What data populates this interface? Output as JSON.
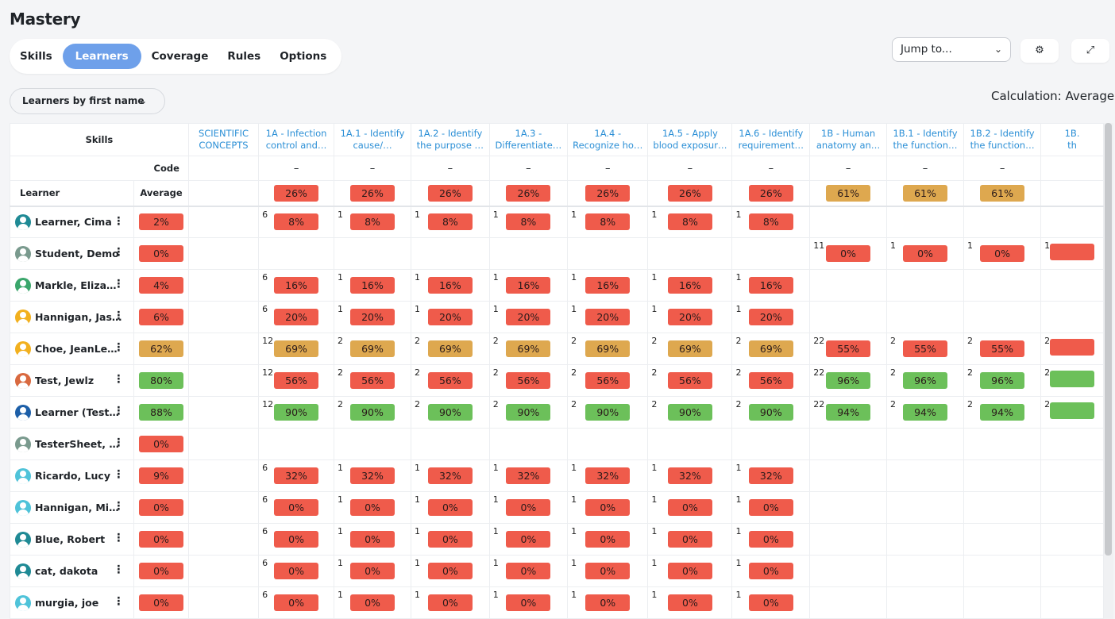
{
  "page": {
    "title": "Mastery"
  },
  "tabs": [
    {
      "label": "Skills",
      "active": false
    },
    {
      "label": "Learners",
      "active": true
    },
    {
      "label": "Coverage",
      "active": false
    },
    {
      "label": "Rules",
      "active": false
    },
    {
      "label": "Options",
      "active": false
    }
  ],
  "toolbar": {
    "jump_label": "Jump to...",
    "settings_icon": "gear-icon",
    "expand_icon": "expand-icon"
  },
  "filter": {
    "label": "Learners by first name"
  },
  "calculation": "Calculation: Average",
  "colors": {
    "accent": "#6ea0ea",
    "red": "#ef5b4b",
    "amber": "#dea84f",
    "green": "#6cc05a",
    "link": "#2b8fd6"
  },
  "grid": {
    "skills_label": "Skills",
    "code_label": "Code",
    "learner_label": "Learner",
    "average_label": "Average",
    "skills": [
      {
        "line1": "SCIENTIFIC",
        "line2": "CONCEPTS",
        "code": "",
        "avg": "",
        "avg_color": ""
      },
      {
        "line1": "1A - Infection",
        "line2": "control and…",
        "code": "–",
        "avg": "26%",
        "avg_color": "red"
      },
      {
        "line1": "1A.1 - Identify",
        "line2": "cause/…",
        "code": "–",
        "avg": "26%",
        "avg_color": "red"
      },
      {
        "line1": "1A.2 - Identify",
        "line2": "the purpose …",
        "code": "–",
        "avg": "26%",
        "avg_color": "red"
      },
      {
        "line1": "1A.3 -",
        "line2": "Differentiate…",
        "code": "–",
        "avg": "26%",
        "avg_color": "red"
      },
      {
        "line1": "1A.4 -",
        "line2": "Recognize ho…",
        "code": "–",
        "avg": "26%",
        "avg_color": "red"
      },
      {
        "line1": "1A.5 - Apply",
        "line2": "blood exposur…",
        "code": "–",
        "avg": "26%",
        "avg_color": "red"
      },
      {
        "line1": "1A.6 - Identify",
        "line2": "requirement…",
        "code": "–",
        "avg": "26%",
        "avg_color": "red"
      },
      {
        "line1": "1B - Human",
        "line2": "anatomy an…",
        "code": "–",
        "avg": "61%",
        "avg_color": "amber"
      },
      {
        "line1": "1B.1 - Identify",
        "line2": "the function…",
        "code": "–",
        "avg": "61%",
        "avg_color": "amber"
      },
      {
        "line1": "1B.2 - Identify",
        "line2": "the function…",
        "code": "–",
        "avg": "61%",
        "avg_color": "amber"
      },
      {
        "line1": "1B.",
        "line2": "th",
        "code": "",
        "avg": "",
        "avg_color": ""
      }
    ],
    "learners": [
      {
        "name": "Learner, Cima",
        "avatar_color": "#1f8a95",
        "avg": "2%",
        "avg_color": "red",
        "cells": [
          null,
          {
            "n": "6",
            "v": "8%",
            "c": "red"
          },
          {
            "n": "1",
            "v": "8%",
            "c": "red"
          },
          {
            "n": "1",
            "v": "8%",
            "c": "red"
          },
          {
            "n": "1",
            "v": "8%",
            "c": "red"
          },
          {
            "n": "1",
            "v": "8%",
            "c": "red"
          },
          {
            "n": "1",
            "v": "8%",
            "c": "red"
          },
          {
            "n": "1",
            "v": "8%",
            "c": "red"
          },
          null,
          null,
          null,
          null
        ]
      },
      {
        "name": "Student, Demo",
        "avatar_color": "#7a9a8e",
        "avg": "0%",
        "avg_color": "red",
        "cells": [
          null,
          null,
          null,
          null,
          null,
          null,
          null,
          null,
          {
            "n": "11",
            "v": "0%",
            "c": "red"
          },
          {
            "n": "1",
            "v": "0%",
            "c": "red"
          },
          {
            "n": "1",
            "v": "0%",
            "c": "red"
          },
          {
            "n": "1",
            "v": "",
            "c": "red"
          }
        ]
      },
      {
        "name": "Markle, Elizabeth",
        "avatar_color": "#3aa66b",
        "avg": "4%",
        "avg_color": "red",
        "cells": [
          null,
          {
            "n": "6",
            "v": "16%",
            "c": "red"
          },
          {
            "n": "1",
            "v": "16%",
            "c": "red"
          },
          {
            "n": "1",
            "v": "16%",
            "c": "red"
          },
          {
            "n": "1",
            "v": "16%",
            "c": "red"
          },
          {
            "n": "1",
            "v": "16%",
            "c": "red"
          },
          {
            "n": "1",
            "v": "16%",
            "c": "red"
          },
          {
            "n": "1",
            "v": "16%",
            "c": "red"
          },
          null,
          null,
          null,
          null
        ]
      },
      {
        "name": "Hannigan, Jason",
        "avatar_color": "#f2b01e",
        "avg": "6%",
        "avg_color": "red",
        "cells": [
          null,
          {
            "n": "6",
            "v": "20%",
            "c": "red"
          },
          {
            "n": "1",
            "v": "20%",
            "c": "red"
          },
          {
            "n": "1",
            "v": "20%",
            "c": "red"
          },
          {
            "n": "1",
            "v": "20%",
            "c": "red"
          },
          {
            "n": "1",
            "v": "20%",
            "c": "red"
          },
          {
            "n": "1",
            "v": "20%",
            "c": "red"
          },
          {
            "n": "1",
            "v": "20%",
            "c": "red"
          },
          null,
          null,
          null,
          null
        ]
      },
      {
        "name": "Choe, JeanLear…",
        "avatar_color": "#f2b01e",
        "avg": "62%",
        "avg_color": "amber",
        "cells": [
          null,
          {
            "n": "12",
            "v": "69%",
            "c": "amber"
          },
          {
            "n": "2",
            "v": "69%",
            "c": "amber"
          },
          {
            "n": "2",
            "v": "69%",
            "c": "amber"
          },
          {
            "n": "2",
            "v": "69%",
            "c": "amber"
          },
          {
            "n": "2",
            "v": "69%",
            "c": "amber"
          },
          {
            "n": "2",
            "v": "69%",
            "c": "amber"
          },
          {
            "n": "2",
            "v": "69%",
            "c": "amber"
          },
          {
            "n": "22",
            "v": "55%",
            "c": "red"
          },
          {
            "n": "2",
            "v": "55%",
            "c": "red"
          },
          {
            "n": "2",
            "v": "55%",
            "c": "red"
          },
          {
            "n": "2",
            "v": "",
            "c": "red"
          }
        ]
      },
      {
        "name": "Test, Jewlz",
        "avatar_color": "#d9693f",
        "avg": "80%",
        "avg_color": "green",
        "cells": [
          null,
          {
            "n": "12",
            "v": "56%",
            "c": "red"
          },
          {
            "n": "2",
            "v": "56%",
            "c": "red"
          },
          {
            "n": "2",
            "v": "56%",
            "c": "red"
          },
          {
            "n": "2",
            "v": "56%",
            "c": "red"
          },
          {
            "n": "2",
            "v": "56%",
            "c": "red"
          },
          {
            "n": "2",
            "v": "56%",
            "c": "red"
          },
          {
            "n": "2",
            "v": "56%",
            "c": "red"
          },
          {
            "n": "22",
            "v": "96%",
            "c": "green"
          },
          {
            "n": "2",
            "v": "96%",
            "c": "green"
          },
          {
            "n": "2",
            "v": "96%",
            "c": "green"
          },
          {
            "n": "2",
            "v": "",
            "c": "green"
          }
        ]
      },
      {
        "name": "Learner (Test), J…",
        "avatar_color": "#1d5fa8",
        "avg": "88%",
        "avg_color": "green",
        "cells": [
          null,
          {
            "n": "12",
            "v": "90%",
            "c": "green"
          },
          {
            "n": "2",
            "v": "90%",
            "c": "green"
          },
          {
            "n": "2",
            "v": "90%",
            "c": "green"
          },
          {
            "n": "2",
            "v": "90%",
            "c": "green"
          },
          {
            "n": "2",
            "v": "90%",
            "c": "green"
          },
          {
            "n": "2",
            "v": "90%",
            "c": "green"
          },
          {
            "n": "2",
            "v": "90%",
            "c": "green"
          },
          {
            "n": "22",
            "v": "94%",
            "c": "green"
          },
          {
            "n": "2",
            "v": "94%",
            "c": "green"
          },
          {
            "n": "2",
            "v": "94%",
            "c": "green"
          },
          {
            "n": "2",
            "v": "",
            "c": "green"
          }
        ]
      },
      {
        "name": "TesterSheet, Julia",
        "avatar_color": "#7a9a8e",
        "avg": "0%",
        "avg_color": "red",
        "cells": [
          null,
          null,
          null,
          null,
          null,
          null,
          null,
          null,
          null,
          null,
          null,
          null
        ]
      },
      {
        "name": "Ricardo, Lucy",
        "avatar_color": "#4fc3d9",
        "avg": "9%",
        "avg_color": "red",
        "cells": [
          null,
          {
            "n": "6",
            "v": "32%",
            "c": "red"
          },
          {
            "n": "1",
            "v": "32%",
            "c": "red"
          },
          {
            "n": "1",
            "v": "32%",
            "c": "red"
          },
          {
            "n": "1",
            "v": "32%",
            "c": "red"
          },
          {
            "n": "1",
            "v": "32%",
            "c": "red"
          },
          {
            "n": "1",
            "v": "32%",
            "c": "red"
          },
          {
            "n": "1",
            "v": "32%",
            "c": "red"
          },
          null,
          null,
          null,
          null
        ]
      },
      {
        "name": "Hannigan, Mich…",
        "avatar_color": "#4fc3d9",
        "avg": "0%",
        "avg_color": "red",
        "cells": [
          null,
          {
            "n": "6",
            "v": "0%",
            "c": "red"
          },
          {
            "n": "1",
            "v": "0%",
            "c": "red"
          },
          {
            "n": "1",
            "v": "0%",
            "c": "red"
          },
          {
            "n": "1",
            "v": "0%",
            "c": "red"
          },
          {
            "n": "1",
            "v": "0%",
            "c": "red"
          },
          {
            "n": "1",
            "v": "0%",
            "c": "red"
          },
          {
            "n": "1",
            "v": "0%",
            "c": "red"
          },
          null,
          null,
          null,
          null
        ]
      },
      {
        "name": "Blue, Robert",
        "avatar_color": "#1f8a95",
        "avg": "0%",
        "avg_color": "red",
        "cells": [
          null,
          {
            "n": "6",
            "v": "0%",
            "c": "red"
          },
          {
            "n": "1",
            "v": "0%",
            "c": "red"
          },
          {
            "n": "1",
            "v": "0%",
            "c": "red"
          },
          {
            "n": "1",
            "v": "0%",
            "c": "red"
          },
          {
            "n": "1",
            "v": "0%",
            "c": "red"
          },
          {
            "n": "1",
            "v": "0%",
            "c": "red"
          },
          {
            "n": "1",
            "v": "0%",
            "c": "red"
          },
          null,
          null,
          null,
          null
        ]
      },
      {
        "name": "cat, dakota",
        "avatar_color": "#1f8a95",
        "avg": "0%",
        "avg_color": "red",
        "cells": [
          null,
          {
            "n": "6",
            "v": "0%",
            "c": "red"
          },
          {
            "n": "1",
            "v": "0%",
            "c": "red"
          },
          {
            "n": "1",
            "v": "0%",
            "c": "red"
          },
          {
            "n": "1",
            "v": "0%",
            "c": "red"
          },
          {
            "n": "1",
            "v": "0%",
            "c": "red"
          },
          {
            "n": "1",
            "v": "0%",
            "c": "red"
          },
          {
            "n": "1",
            "v": "0%",
            "c": "red"
          },
          null,
          null,
          null,
          null
        ]
      },
      {
        "name": "murgia, joe",
        "avatar_color": "#4fc3d9",
        "avg": "0%",
        "avg_color": "red",
        "cells": [
          null,
          {
            "n": "6",
            "v": "0%",
            "c": "red"
          },
          {
            "n": "1",
            "v": "0%",
            "c": "red"
          },
          {
            "n": "1",
            "v": "0%",
            "c": "red"
          },
          {
            "n": "1",
            "v": "0%",
            "c": "red"
          },
          {
            "n": "1",
            "v": "0%",
            "c": "red"
          },
          {
            "n": "1",
            "v": "0%",
            "c": "red"
          },
          {
            "n": "1",
            "v": "0%",
            "c": "red"
          },
          null,
          null,
          null,
          null
        ]
      }
    ]
  }
}
